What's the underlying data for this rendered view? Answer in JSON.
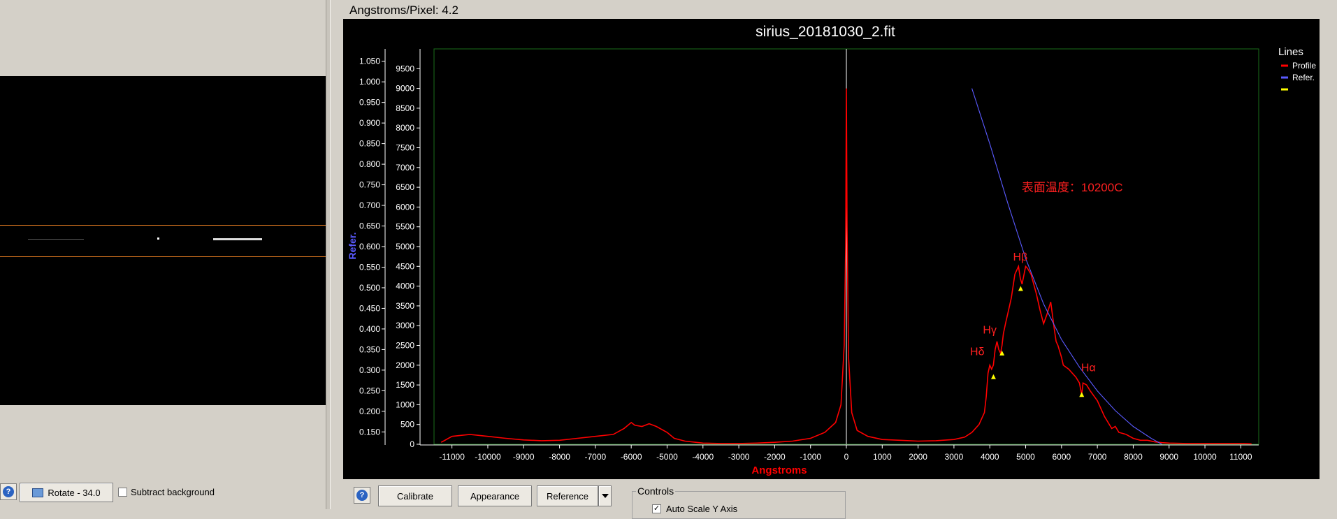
{
  "left_panel": {
    "rotate_button": "Rotate - 34.0",
    "subtract_background_label": "Subtract background",
    "subtract_background_checked": false
  },
  "header": {
    "angstroms_per_pixel": "Angstroms/Pixel: 4.2"
  },
  "bottom_toolbar": {
    "calibrate_label": "Calibrate",
    "appearance_label": "Appearance",
    "reference_label": "Reference",
    "controls_label": "Controls",
    "auto_scale_label": "Auto Scale Y Axis",
    "auto_scale_checked": true
  },
  "colors": {
    "profile": "#ff0000",
    "reference": "#5a5aff",
    "marker": "#ffff00",
    "annotation": "#ff2020",
    "plot_bg": "#000000",
    "plot_frame": "#1a6e1a"
  },
  "chart_data": {
    "type": "line",
    "title": "sirius_20181030_2.fit",
    "xlabel": "Angstroms",
    "ylabel_right": "Refer.",
    "xlim": [
      -11500,
      11500
    ],
    "ylim_left": [
      0,
      10000
    ],
    "ylim_right": [
      0.12,
      1.08
    ],
    "x_ticks": [
      "-11000",
      "-10000",
      "-9000",
      "-8000",
      "-7000",
      "-6000",
      "-5000",
      "-4000",
      "-3000",
      "-2000",
      "-1000",
      "0",
      "1000",
      "2000",
      "3000",
      "4000",
      "5000",
      "6000",
      "7000",
      "8000",
      "9000",
      "10000",
      "11000"
    ],
    "y_ticks_left": [
      "0",
      "500",
      "1000",
      "1500",
      "2000",
      "2500",
      "3000",
      "3500",
      "4000",
      "4500",
      "5000",
      "5500",
      "6000",
      "6500",
      "7000",
      "7500",
      "8000",
      "8500",
      "9000",
      "9500"
    ],
    "y_ticks_right": [
      "0.150",
      "0.200",
      "0.250",
      "0.300",
      "0.350",
      "0.400",
      "0.450",
      "0.500",
      "0.550",
      "0.600",
      "0.650",
      "0.700",
      "0.750",
      "0.800",
      "0.850",
      "0.900",
      "0.950",
      "1.000",
      "1.050"
    ],
    "legend": {
      "title": "Lines",
      "entries": [
        {
          "name": "Profile",
          "color": "#ff0000"
        },
        {
          "name": "Refer.",
          "color": "#5a5aff"
        },
        {
          "name": "",
          "color": "#ffff00"
        }
      ],
      "position": "top-right"
    },
    "annotations": [
      {
        "text": "表面温度：10200C",
        "x": 6300,
        "y": 6400
      },
      {
        "text": "Hβ",
        "x": 4850,
        "y": 4650
      },
      {
        "text": "Hγ",
        "x": 4000,
        "y": 2800
      },
      {
        "text": "Hδ",
        "x": 3650,
        "y": 2250
      },
      {
        "text": "Hα",
        "x": 6750,
        "y": 1850
      }
    ],
    "markers": [
      {
        "x": 4102,
        "y": 1700
      },
      {
        "x": 4340,
        "y": 2300
      },
      {
        "x": 4861,
        "y": 3930
      },
      {
        "x": 6563,
        "y": 1250
      }
    ],
    "series": [
      {
        "name": "Profile",
        "color": "#ff0000",
        "x": [
          -11300,
          -11000,
          -10500,
          -10000,
          -9500,
          -9000,
          -8500,
          -8000,
          -7500,
          -7200,
          -7000,
          -6500,
          -6200,
          -6000,
          -5900,
          -5700,
          -5500,
          -5300,
          -5000,
          -4800,
          -4500,
          -4200,
          -4000,
          -3500,
          -3000,
          -2500,
          -2000,
          -1500,
          -1000,
          -600,
          -300,
          -150,
          -60,
          -20,
          0,
          20,
          60,
          150,
          300,
          600,
          1000,
          1500,
          2000,
          2500,
          3000,
          3300,
          3500,
          3700,
          3850,
          3900,
          3950,
          4000,
          4050,
          4100,
          4150,
          4200,
          4250,
          4300,
          4340,
          4380,
          4450,
          4500,
          4600,
          4700,
          4800,
          4850,
          4900,
          5000,
          5050,
          5150,
          5300,
          5400,
          5500,
          5600,
          5700,
          5800,
          5850,
          5900,
          6000,
          6050,
          6200,
          6400,
          6500,
          6563,
          6600,
          6700,
          6800,
          7000,
          7200,
          7400,
          7500,
          7600,
          7800,
          8000,
          8200,
          8400,
          8600,
          8800,
          9000,
          9500,
          10000,
          10500,
          11000,
          11300
        ],
        "y": [
          50,
          200,
          250,
          200,
          150,
          110,
          90,
          100,
          150,
          180,
          200,
          250,
          400,
          550,
          480,
          450,
          520,
          450,
          300,
          150,
          80,
          50,
          30,
          20,
          20,
          30,
          50,
          80,
          150,
          300,
          550,
          1000,
          2500,
          5000,
          9000,
          5500,
          2200,
          800,
          350,
          200,
          120,
          100,
          80,
          90,
          120,
          180,
          300,
          500,
          800,
          1200,
          1800,
          2000,
          1900,
          2000,
          2400,
          2600,
          2400,
          2300,
          2500,
          2800,
          3100,
          3300,
          3700,
          4300,
          4500,
          4200,
          4050,
          4500,
          4450,
          4300,
          3800,
          3400,
          3050,
          3300,
          3600,
          2900,
          2600,
          2500,
          2200,
          2000,
          1900,
          1700,
          1550,
          1250,
          1550,
          1500,
          1350,
          1100,
          700,
          400,
          450,
          300,
          250,
          150,
          100,
          100,
          60,
          40,
          30,
          20,
          20,
          20,
          20,
          10
        ]
      },
      {
        "name": "Refer.",
        "color": "#5a5aff",
        "x": [
          3500,
          4000,
          4500,
          5000,
          5500,
          6000,
          6500,
          7000,
          7500,
          8000,
          8500,
          8800
        ],
        "y": [
          9000,
          7600,
          6100,
          4700,
          3550,
          2650,
          1950,
          1350,
          850,
          450,
          150,
          0
        ]
      }
    ]
  }
}
